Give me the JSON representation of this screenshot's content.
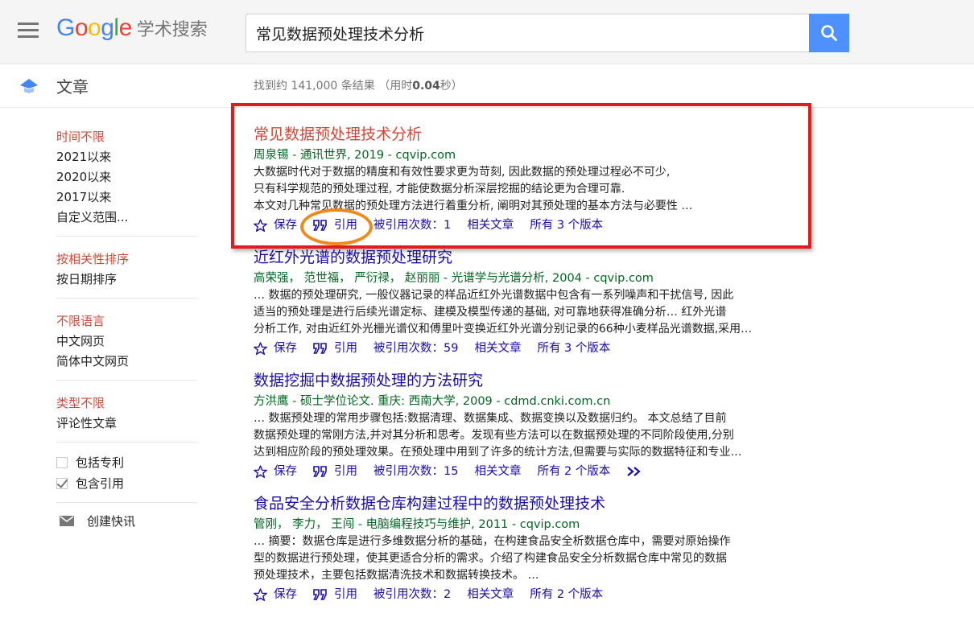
{
  "header": {
    "logo_word": "Google",
    "logo_product": "学术搜索",
    "search_value": "常见数据预处理技术分析"
  },
  "subbar": {
    "section_label": "文章",
    "count_prefix": "找到约 141,000 条结果 （用时",
    "count_time": "0.04",
    "count_suffix": "秒）"
  },
  "sidebar": {
    "time_filters": [
      "时间不限",
      "2021以来",
      "2020以来",
      "2017以来",
      "自定义范围..."
    ],
    "sort_options": [
      "按相关性排序",
      "按日期排序"
    ],
    "language_options": [
      "不限语言",
      "中文网页",
      "简体中文网页"
    ],
    "type_options": [
      "类型不限",
      "评论性文章"
    ],
    "checkboxes": [
      {
        "label": "包括专利",
        "checked": false
      },
      {
        "label": "包含引用",
        "checked": true
      }
    ],
    "create_alert": "创建快讯"
  },
  "results": [
    {
      "title": "常见数据预处理技术分析",
      "meta": "周泉锡 - 通讯世界, 2019 - cqvip.com",
      "snippet": [
        "大数据时代对于数据的精度和有效性要求更为苛刻, 因此数据的预处理过程必不可少,",
        "只有科学规范的预处理过程, 才能使数据分析深层挖掘的结论更为合理可靠.",
        "本文对几种常见数据的预处理方法进行着重分析, 阐明对其预处理的基本方法与必要性 …"
      ],
      "actions": {
        "save": "保存",
        "cite": "引用",
        "cited_by": "被引用次数：1",
        "related": "相关文章",
        "versions": "所有 3 个版本"
      }
    },
    {
      "title": "近红外光谱的数据预处理研究",
      "meta": "高荣强， 范世福， 严衍禄， 赵丽丽 - 光谱学与光谱分析, 2004 - cqvip.com",
      "snippet": [
        "… 数据的预处理研究, 一般仪器记录的样品近红外光谱数据中包含有一系列噪声和干扰信号, 因此",
        "适当的预处理是进行后续光谱定标、建模及模型传递的基础, 对可靠地获得准确分析… 红外光谱",
        "分析工作, 对由近红外光栅光谱仪和傅里叶变换近红外光谱分别记录的66种小麦样品光谱数据,采用…"
      ],
      "actions": {
        "save": "保存",
        "cite": "引用",
        "cited_by": "被引用次数：59",
        "related": "相关文章",
        "versions": "所有 3 个版本"
      }
    },
    {
      "title": "数据挖掘中数据预处理的方法研究",
      "meta": "方洪鹰 - 硕士学位论文. 重庆: 西南大学, 2009 - cdmd.cnki.com.cn",
      "snippet": [
        "… 数据预处理的常用步骤包括:数据清理、数据集成、数据变换以及数据归约。 本文总结了目前",
        "数据预处理的常刚方法,并对其分析和思考。发现有些方法可以在数据预处理的不同阶段使用,分别",
        "达到相应阶段的预处理效果。在预处理中用到了许多的统计方法,但需要与实际的数据特征和专业…"
      ],
      "actions": {
        "save": "保存",
        "cite": "引用",
        "cited_by": "被引用次数：15",
        "related": "相关文章",
        "versions": "所有 2 个版本"
      }
    },
    {
      "title": "食品安全分析数据仓库构建过程中的数据预处理技术",
      "meta": "管刚， 李力， 王闯 - 电脑编程技巧与维护, 2011 - cqvip.com",
      "snippet": [
        "… 摘要：数据仓库是进行多维数据分析的基础，在构建食品安全析数据仓库中，需要对原始操作",
        "型的数据进行预处理，使其更适合分析的需求。介绍了构建食品安全分析数据仓库中常见的数据",
        "预处理技术，主要包括数据清洗技术和数据转换技术。 …"
      ],
      "actions": {
        "save": "保存",
        "cite": "引用",
        "cited_by": "被引用次数：2",
        "related": "相关文章",
        "versions": "所有 2 个版本"
      }
    }
  ],
  "colors": {
    "accent_red": "#d14836",
    "link_blue": "#1a0dab",
    "meta_green": "#006621",
    "highlight_box": "#e21b1b",
    "highlight_ellipse": "#ef8a1a"
  }
}
